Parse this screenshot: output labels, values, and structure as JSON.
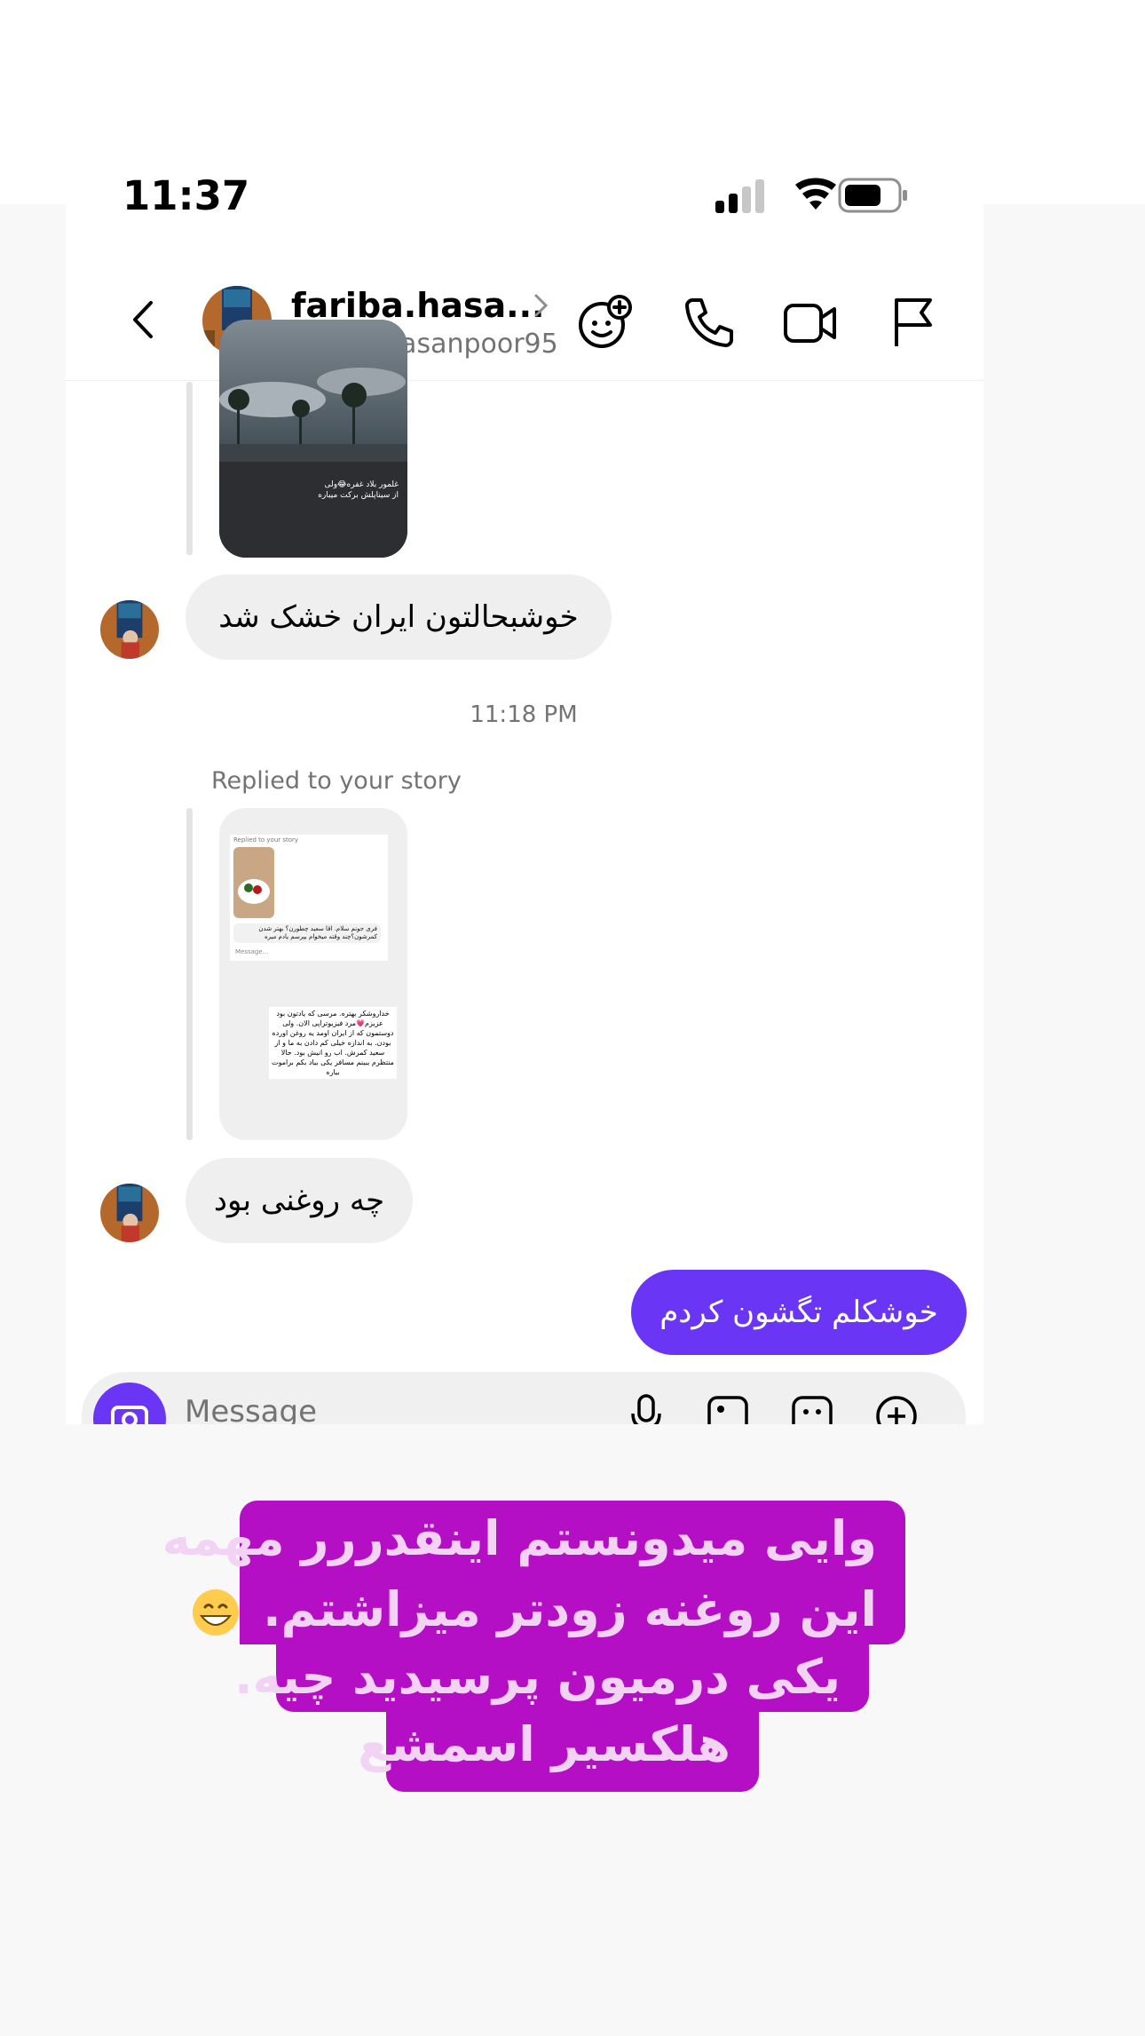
{
  "status_bar": {
    "time": "11:37"
  },
  "header": {
    "display_name": "fariba.hasa...",
    "username": "fariba_hasanpoor95",
    "icons": [
      "back-icon",
      "sticker-add-icon",
      "phone-icon",
      "video-icon",
      "flag-icon"
    ]
  },
  "thread": {
    "story_1_caption": "غلمور بلاد غفره😂ولی از سیناپلش برکت میباره",
    "message_1": "خوشبحالتون ایران خشک شد",
    "timestamp": "11:18 PM",
    "replied_label": "Replied to your story",
    "story_2": {
      "inner_label": "Replied to your story",
      "inner_text": "فری جونم سلام. اقا سعید چطورن؟ بهتر شدن کمرشون؟چند وقته میخوام بپرسم یادم میره",
      "inner_placeholder": "Message...",
      "caption": "خداروشکر بهتره. مرسی که یادتون بود عزیزم💗مرد فیزیوتراپی الان. ولی دوستمون که از ایران اومد یه روغن اورده بودن. به اندازه خیلی کم دادن به ما و از سعید کمرش. اب رو انیش بود. حالا منتظرم ببینم مسافر یکی بیاد بکم براموت بیاره"
    },
    "message_2": "چه روغنی بود",
    "message_3_outgoing": "خوشکلم تگشون کردم"
  },
  "composer": {
    "placeholder": "Message"
  },
  "overlay_caption": {
    "line_1": "وایی میدونستم اینقدررر مهمه",
    "line_2_text": "این روغنه زودتر میزاشتم.",
    "line_2_emoji": "grinning-face-emoji",
    "line_3": "یکی درمیون پرسیدید چیه.",
    "line_4": "هلکسیر اسمشع"
  },
  "colors": {
    "accent": "#6a35f5",
    "caption_bg": "#b40fc4",
    "caption_text": "#f3d3f4",
    "incoming_bubble": "#efefef"
  }
}
